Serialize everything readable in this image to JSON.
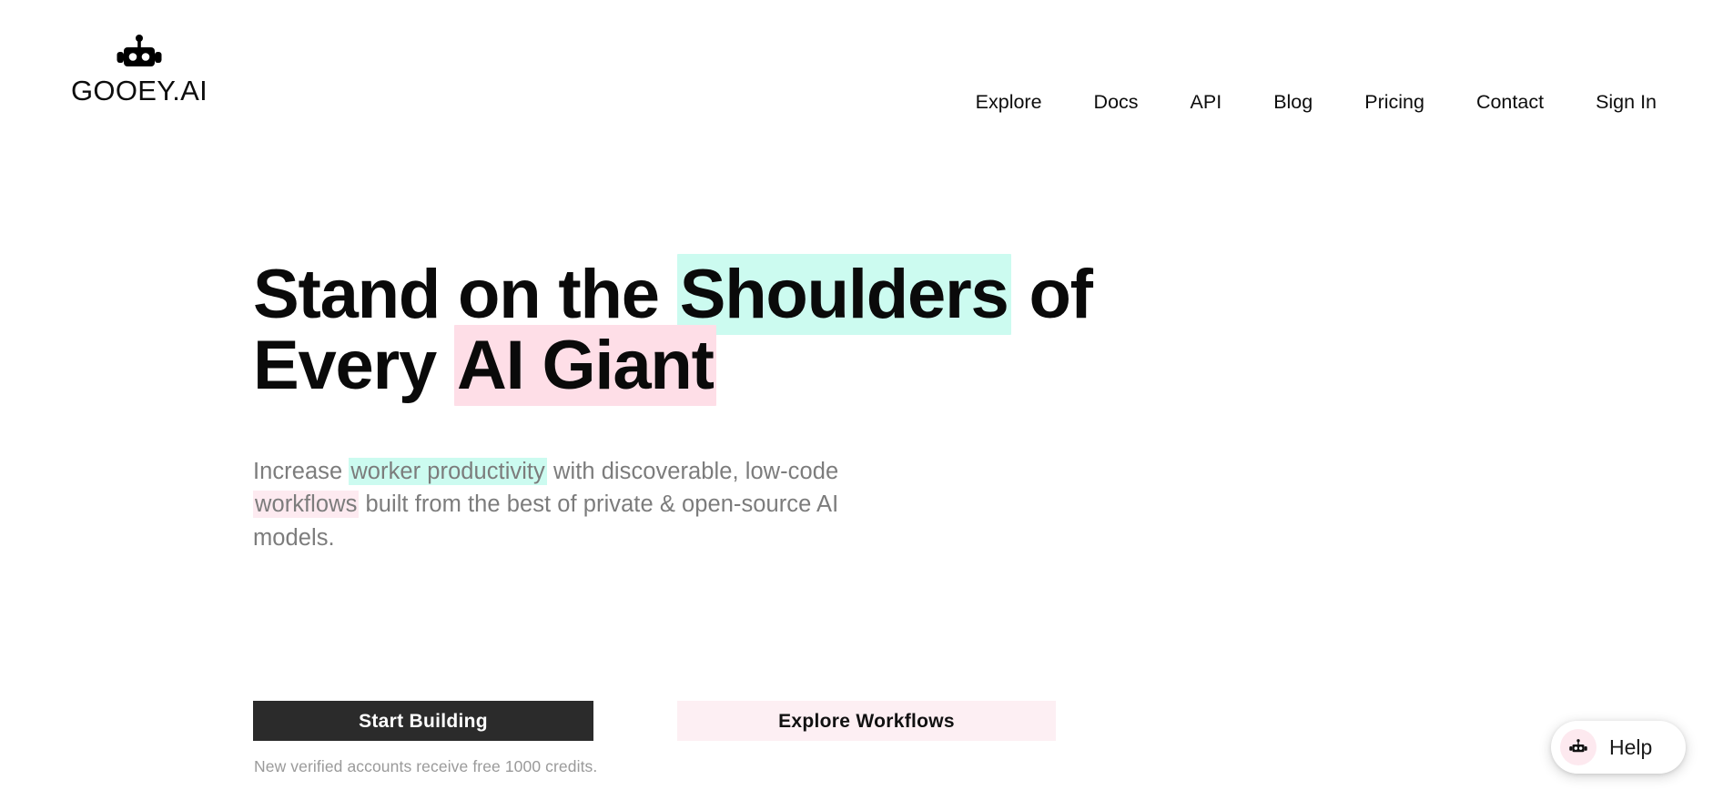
{
  "header": {
    "brand": {
      "name": "GOOEY.AI",
      "logo_icon": "robot-head-icon"
    },
    "nav": [
      {
        "label": "Explore",
        "name": "nav-link-explore"
      },
      {
        "label": "Docs",
        "name": "nav-link-docs"
      },
      {
        "label": "API",
        "name": "nav-link-api"
      },
      {
        "label": "Blog",
        "name": "nav-link-blog"
      },
      {
        "label": "Pricing",
        "name": "nav-link-pricing"
      },
      {
        "label": "Contact",
        "name": "nav-link-contact"
      },
      {
        "label": "Sign In",
        "name": "nav-link-sign-in"
      }
    ]
  },
  "hero": {
    "headline": {
      "line1_part1": "Stand on the ",
      "line1_highlight": "Shoulders",
      "line1_part2": " of",
      "line2_part1": "Every ",
      "line2_highlight": "AI Giant"
    },
    "subhead": {
      "part1": "Increase ",
      "highlight1": "worker productivity",
      "part2": " with discoverable, low-code ",
      "highlight2": "workflows",
      "part3": " built from the best of private & open-source AI models."
    },
    "primary_cta": "Start Building",
    "secondary_cta": "Explore Workflows",
    "fineprint": "New verified accounts receive free 1000 credits."
  },
  "help_widget": {
    "label": "Help",
    "icon": "robot-head-icon"
  },
  "colors": {
    "mint_highlight": "#ccfbf0",
    "pink_highlight": "#fedee7",
    "pink_soft": "#fdeaf0",
    "primary_button_bg": "#2b2b2b",
    "secondary_button_bg": "#fdeff3",
    "text_primary": "#0a0a0a",
    "text_muted": "#7c7c7c",
    "fineprint": "#9a9a9a",
    "page_bg": "#ffffff"
  }
}
